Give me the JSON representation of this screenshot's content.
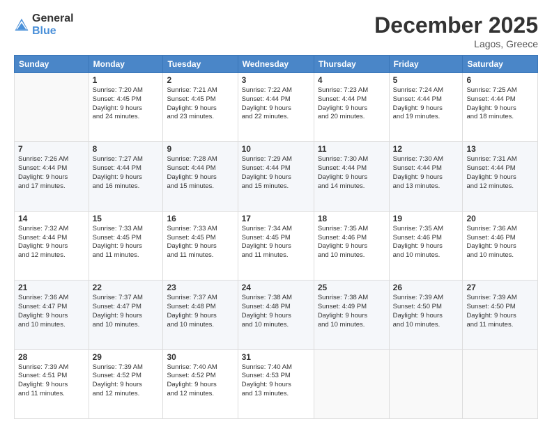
{
  "header": {
    "logo_general": "General",
    "logo_blue": "Blue",
    "month_year": "December 2025",
    "location": "Lagos, Greece"
  },
  "days_of_week": [
    "Sunday",
    "Monday",
    "Tuesday",
    "Wednesday",
    "Thursday",
    "Friday",
    "Saturday"
  ],
  "weeks": [
    [
      {
        "day": "",
        "info": ""
      },
      {
        "day": "1",
        "info": "Sunrise: 7:20 AM\nSunset: 4:45 PM\nDaylight: 9 hours\nand 24 minutes."
      },
      {
        "day": "2",
        "info": "Sunrise: 7:21 AM\nSunset: 4:45 PM\nDaylight: 9 hours\nand 23 minutes."
      },
      {
        "day": "3",
        "info": "Sunrise: 7:22 AM\nSunset: 4:44 PM\nDaylight: 9 hours\nand 22 minutes."
      },
      {
        "day": "4",
        "info": "Sunrise: 7:23 AM\nSunset: 4:44 PM\nDaylight: 9 hours\nand 20 minutes."
      },
      {
        "day": "5",
        "info": "Sunrise: 7:24 AM\nSunset: 4:44 PM\nDaylight: 9 hours\nand 19 minutes."
      },
      {
        "day": "6",
        "info": "Sunrise: 7:25 AM\nSunset: 4:44 PM\nDaylight: 9 hours\nand 18 minutes."
      }
    ],
    [
      {
        "day": "7",
        "info": "Sunrise: 7:26 AM\nSunset: 4:44 PM\nDaylight: 9 hours\nand 17 minutes."
      },
      {
        "day": "8",
        "info": "Sunrise: 7:27 AM\nSunset: 4:44 PM\nDaylight: 9 hours\nand 16 minutes."
      },
      {
        "day": "9",
        "info": "Sunrise: 7:28 AM\nSunset: 4:44 PM\nDaylight: 9 hours\nand 15 minutes."
      },
      {
        "day": "10",
        "info": "Sunrise: 7:29 AM\nSunset: 4:44 PM\nDaylight: 9 hours\nand 15 minutes."
      },
      {
        "day": "11",
        "info": "Sunrise: 7:30 AM\nSunset: 4:44 PM\nDaylight: 9 hours\nand 14 minutes."
      },
      {
        "day": "12",
        "info": "Sunrise: 7:30 AM\nSunset: 4:44 PM\nDaylight: 9 hours\nand 13 minutes."
      },
      {
        "day": "13",
        "info": "Sunrise: 7:31 AM\nSunset: 4:44 PM\nDaylight: 9 hours\nand 12 minutes."
      }
    ],
    [
      {
        "day": "14",
        "info": "Sunrise: 7:32 AM\nSunset: 4:44 PM\nDaylight: 9 hours\nand 12 minutes."
      },
      {
        "day": "15",
        "info": "Sunrise: 7:33 AM\nSunset: 4:45 PM\nDaylight: 9 hours\nand 11 minutes."
      },
      {
        "day": "16",
        "info": "Sunrise: 7:33 AM\nSunset: 4:45 PM\nDaylight: 9 hours\nand 11 minutes."
      },
      {
        "day": "17",
        "info": "Sunrise: 7:34 AM\nSunset: 4:45 PM\nDaylight: 9 hours\nand 11 minutes."
      },
      {
        "day": "18",
        "info": "Sunrise: 7:35 AM\nSunset: 4:46 PM\nDaylight: 9 hours\nand 10 minutes."
      },
      {
        "day": "19",
        "info": "Sunrise: 7:35 AM\nSunset: 4:46 PM\nDaylight: 9 hours\nand 10 minutes."
      },
      {
        "day": "20",
        "info": "Sunrise: 7:36 AM\nSunset: 4:46 PM\nDaylight: 9 hours\nand 10 minutes."
      }
    ],
    [
      {
        "day": "21",
        "info": "Sunrise: 7:36 AM\nSunset: 4:47 PM\nDaylight: 9 hours\nand 10 minutes."
      },
      {
        "day": "22",
        "info": "Sunrise: 7:37 AM\nSunset: 4:47 PM\nDaylight: 9 hours\nand 10 minutes."
      },
      {
        "day": "23",
        "info": "Sunrise: 7:37 AM\nSunset: 4:48 PM\nDaylight: 9 hours\nand 10 minutes."
      },
      {
        "day": "24",
        "info": "Sunrise: 7:38 AM\nSunset: 4:48 PM\nDaylight: 9 hours\nand 10 minutes."
      },
      {
        "day": "25",
        "info": "Sunrise: 7:38 AM\nSunset: 4:49 PM\nDaylight: 9 hours\nand 10 minutes."
      },
      {
        "day": "26",
        "info": "Sunrise: 7:39 AM\nSunset: 4:50 PM\nDaylight: 9 hours\nand 10 minutes."
      },
      {
        "day": "27",
        "info": "Sunrise: 7:39 AM\nSunset: 4:50 PM\nDaylight: 9 hours\nand 11 minutes."
      }
    ],
    [
      {
        "day": "28",
        "info": "Sunrise: 7:39 AM\nSunset: 4:51 PM\nDaylight: 9 hours\nand 11 minutes."
      },
      {
        "day": "29",
        "info": "Sunrise: 7:39 AM\nSunset: 4:52 PM\nDaylight: 9 hours\nand 12 minutes."
      },
      {
        "day": "30",
        "info": "Sunrise: 7:40 AM\nSunset: 4:52 PM\nDaylight: 9 hours\nand 12 minutes."
      },
      {
        "day": "31",
        "info": "Sunrise: 7:40 AM\nSunset: 4:53 PM\nDaylight: 9 hours\nand 13 minutes."
      },
      {
        "day": "",
        "info": ""
      },
      {
        "day": "",
        "info": ""
      },
      {
        "day": "",
        "info": ""
      }
    ]
  ]
}
